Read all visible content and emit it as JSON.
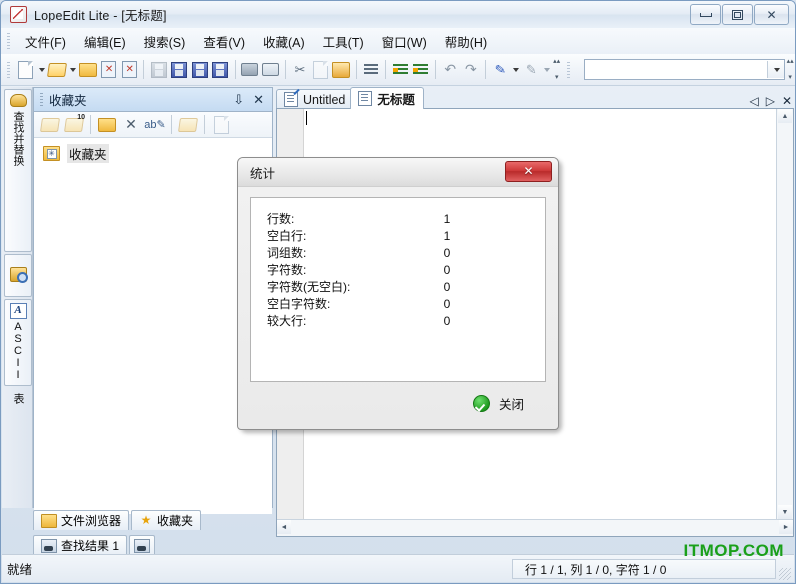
{
  "window": {
    "title": "LopeEdit Lite - [无标题]",
    "icon": "pencil-icon",
    "buttons": {
      "minimize": "minimize-icon",
      "maximize": "maximize-icon",
      "close": "close-icon"
    }
  },
  "menubar": {
    "items": [
      {
        "label": "文件(F)"
      },
      {
        "label": "编辑(E)"
      },
      {
        "label": "搜索(S)"
      },
      {
        "label": "查看(V)"
      },
      {
        "label": "收藏(A)"
      },
      {
        "label": "工具(T)"
      },
      {
        "label": "窗口(W)"
      },
      {
        "label": "帮助(H)"
      }
    ]
  },
  "toolbar": {
    "icons": [
      "new-file-icon",
      "new-file-dropdown",
      "open-file-icon",
      "open-file-dropdown",
      "open-folder-icon",
      "close-file-icon",
      "close-all-icon",
      "save-icon",
      "save-as-icon",
      "save-all-icon",
      "save-remote-icon",
      "print-icon",
      "print-preview-icon",
      "cut-icon",
      "copy-icon",
      "paste-icon",
      "format-lines-icon",
      "indent-increase-icon",
      "indent-decrease-icon",
      "undo-icon",
      "redo-icon",
      "highlight-icon",
      "highlight-dropdown",
      "clear-format-icon",
      "clear-format-dropdown"
    ],
    "combo_value": "",
    "combo_placeholder": ""
  },
  "vertical_tabs": [
    {
      "label": "查找并替换",
      "icon": "binoculars-icon"
    },
    {
      "label": "",
      "icon": "find-replace-icon"
    },
    {
      "label": "ASCII 表",
      "icon": "ascii-icon"
    }
  ],
  "favorites_panel": {
    "title": "收藏夹",
    "pin_icon": "pin-icon",
    "close_icon": "close-icon",
    "toolbar_icons": [
      "open-favorite-icon",
      "open-favorite-10-icon",
      "new-folder-icon",
      "delete-icon",
      "rename-icon",
      "add-favorite-icon",
      "properties-icon"
    ],
    "badge": "10",
    "tree": [
      {
        "label": "收藏夹",
        "icon": "favorites-folder-icon"
      }
    ]
  },
  "panel_tabs": [
    {
      "label": "文件浏览器",
      "icon": "folder-icon",
      "active": false
    },
    {
      "label": "收藏夹",
      "icon": "star-icon",
      "active": true
    }
  ],
  "results_tabs": [
    {
      "label": "查找结果 1",
      "icon": "search-results-icon",
      "active": true
    },
    {
      "label": "",
      "icon": "search-results-icon",
      "active": false
    }
  ],
  "editor": {
    "tabs": [
      {
        "label": "Untitled",
        "icon": "document-edit-icon",
        "active": false
      },
      {
        "label": "无标题",
        "icon": "document-icon",
        "active": true
      }
    ],
    "nav": {
      "prev": "◁",
      "next": "▷",
      "close": "✕"
    },
    "content": "",
    "scroll": {
      "up": "▲",
      "down": "▼",
      "left": "◄",
      "right": "►"
    }
  },
  "statusbar": {
    "message": "就绪",
    "position": "行 1 / 1, 列 1 / 0, 字符 1 / 0",
    "watermark": "ITMOP.COM",
    "watermark_color": "#1aa01a"
  },
  "dialog": {
    "title": "统计",
    "close_icon": "close-icon",
    "stats": [
      {
        "label": "行数:",
        "value": "1"
      },
      {
        "label": "空白行:",
        "value": "1"
      },
      {
        "label": "词组数:",
        "value": "0"
      },
      {
        "label": "字符数:",
        "value": "0"
      },
      {
        "label": "字符数(无空白):",
        "value": "0"
      },
      {
        "label": "空白字符数:",
        "value": "0"
      },
      {
        "label": "较大行:",
        "value": "0"
      }
    ],
    "ok_label": "关闭",
    "ok_icon": "check-circle-icon"
  }
}
